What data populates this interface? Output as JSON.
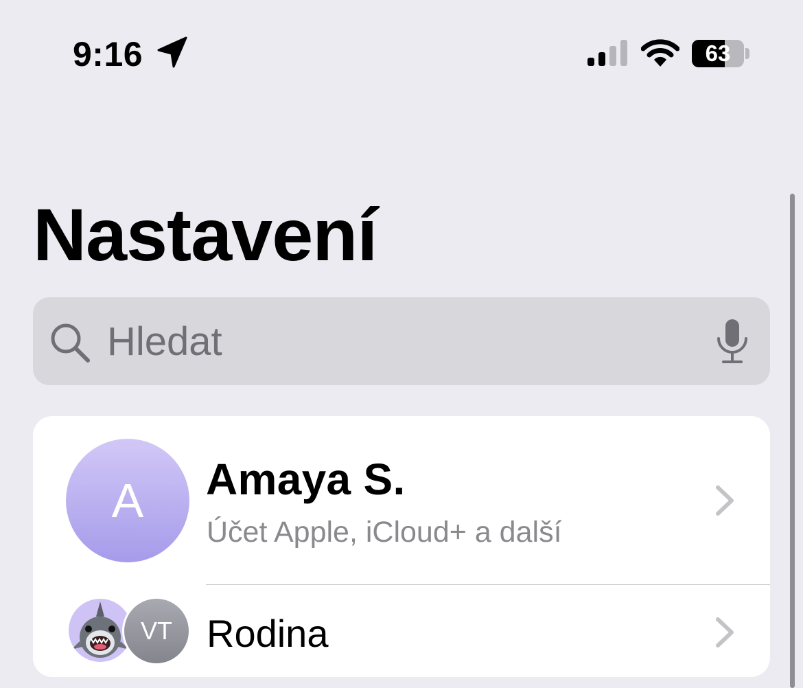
{
  "status_bar": {
    "time": "9:16",
    "battery_level": "63",
    "battery_fraction": 0.63,
    "icons": [
      "location-arrow-icon",
      "cellular-signal-icon",
      "wifi-icon",
      "battery-icon"
    ]
  },
  "header": {
    "title": "Nastavení"
  },
  "search": {
    "placeholder": "Hledat",
    "value": "",
    "icons": [
      "search-icon",
      "microphone-icon"
    ]
  },
  "account": {
    "avatar_initial": "A",
    "name": "Amaya S.",
    "subtitle": "Účet Apple, iCloud+ a další"
  },
  "family": {
    "label": "Rodina",
    "member_initials": "VT",
    "icons": [
      "shark-memoji-icon"
    ]
  },
  "colors": {
    "background": "#ebebf1",
    "card": "#ffffff",
    "search_field": "#d7d7dc",
    "secondary_text": "#8a8a8e",
    "chevron": "#c4c4c7",
    "avatar_purple": "#b8aef0"
  }
}
